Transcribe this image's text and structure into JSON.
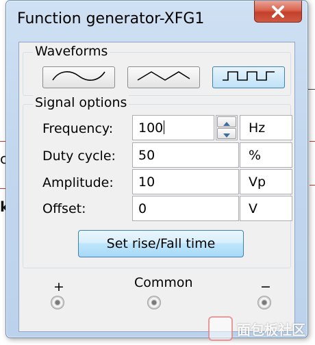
{
  "window": {
    "title": "Function generator-XFG1"
  },
  "close_glyph": "✕",
  "waveforms": {
    "label": "Waveforms",
    "buttons": [
      {
        "name": "sine-wave-icon",
        "active": false
      },
      {
        "name": "triangle-wave-icon",
        "active": false
      },
      {
        "name": "square-wave-icon",
        "active": true
      }
    ]
  },
  "signal_options": {
    "label": "Signal options",
    "fields": [
      {
        "label": "Frequency:",
        "value": "100",
        "unit": "Hz"
      },
      {
        "label": "Duty cycle:",
        "value": "50",
        "unit": "%"
      },
      {
        "label": "Amplitude:",
        "value": "10",
        "unit": "Vp"
      },
      {
        "label": "Offset:",
        "value": "0",
        "unit": "V"
      }
    ]
  },
  "rise_fall_button": "Set rise/Fall time",
  "terminals": {
    "plus": "+",
    "common": "Common",
    "minus": "−"
  },
  "background": {
    "text_c": "c",
    "text_k": "k"
  },
  "colors": {
    "accent": "#3c7fb1",
    "close": "#c33f2a"
  },
  "watermark": "面包板社区"
}
